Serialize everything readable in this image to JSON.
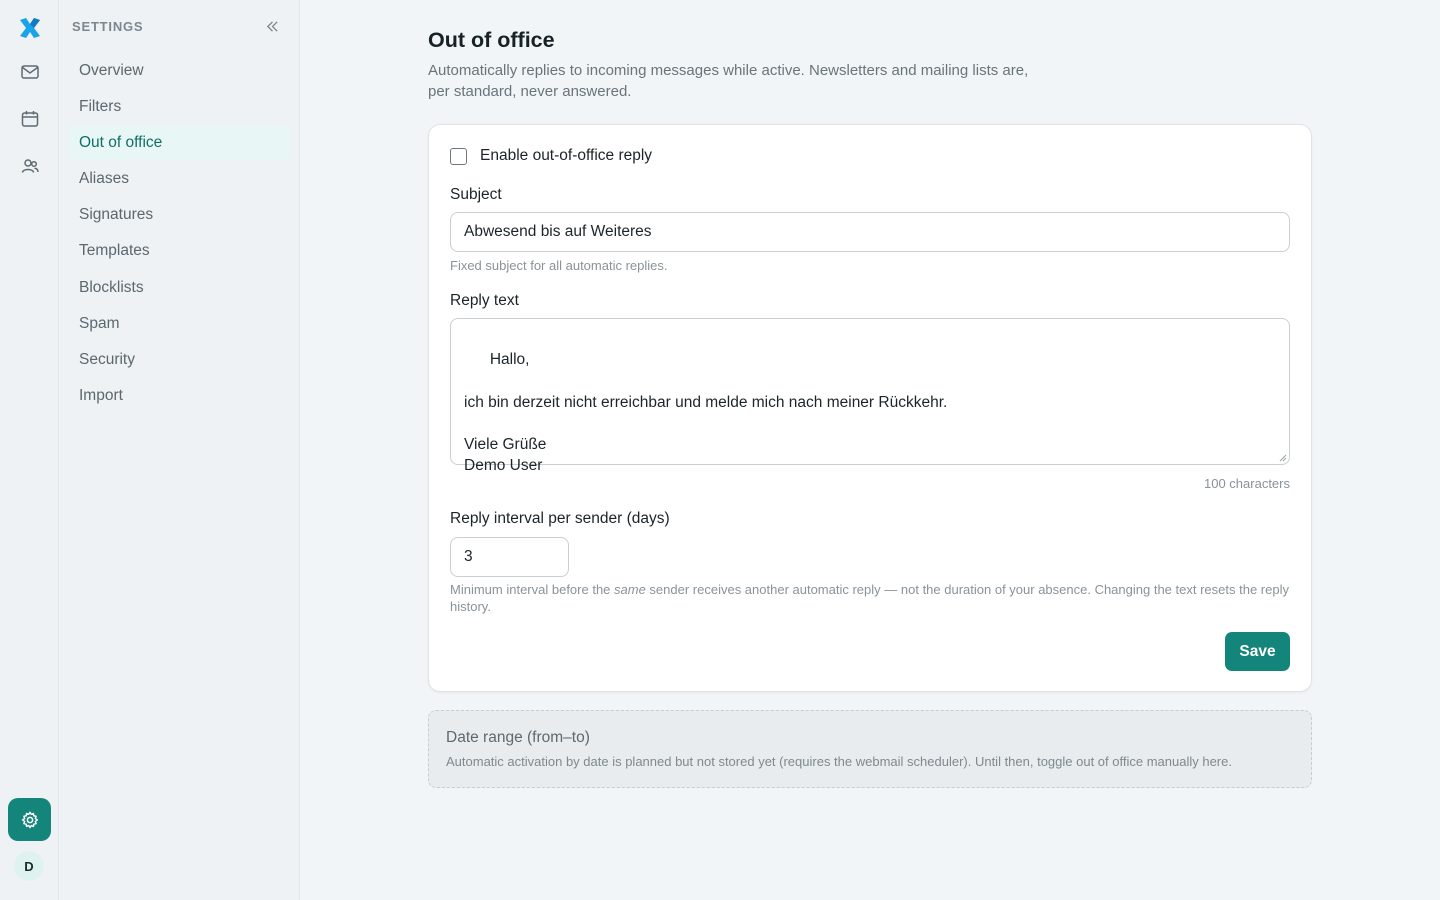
{
  "sidebar": {
    "title": "SETTINGS",
    "items": [
      {
        "label": "Overview"
      },
      {
        "label": "Filters"
      },
      {
        "label": "Out of office",
        "active": true
      },
      {
        "label": "Aliases"
      },
      {
        "label": "Signatures"
      },
      {
        "label": "Templates"
      },
      {
        "label": "Blocklists"
      },
      {
        "label": "Spam"
      },
      {
        "label": "Security"
      },
      {
        "label": "Import"
      }
    ]
  },
  "rail": {
    "icons": [
      "logo-icon",
      "mail-icon",
      "calendar-icon",
      "contacts-icon",
      "settings-icon"
    ],
    "avatar_initial": "D"
  },
  "page": {
    "title": "Out of office",
    "description": "Automatically replies to incoming messages while active. Newsletters and mailing lists are, per standard, never answered."
  },
  "form": {
    "enable_label": "Enable out-of-office reply",
    "enabled": false,
    "subject_label": "Subject",
    "subject_value": "Abwesend bis auf Weiteres",
    "subject_hint": "Fixed subject for all automatic replies.",
    "reply_label": "Reply text",
    "reply_value": "Hallo,\n\nich bin derzeit nicht erreichbar und melde mich nach meiner Rückkehr.\n\nViele Grüße\nDemo User",
    "char_count": "100 characters",
    "interval_label": "Reply interval per sender (days)",
    "interval_value": "3",
    "interval_hint_before": "Minimum interval before the ",
    "interval_hint_em": "same",
    "interval_hint_after": " sender receives another automatic reply — not the duration of your absence. Changing the text resets the reply history.",
    "save_label": "Save"
  },
  "date_range": {
    "title": "Date range (from–to)",
    "description": "Automatic activation by date is planned but not stored yet (requires the webmail scheduler). Until then, toggle out of office manually here."
  },
  "colors": {
    "accent": "#14857a",
    "active_nav_bg": "#e8f7f5",
    "active_nav_text": "#0f6f67",
    "logo": "#1aa3e8"
  }
}
